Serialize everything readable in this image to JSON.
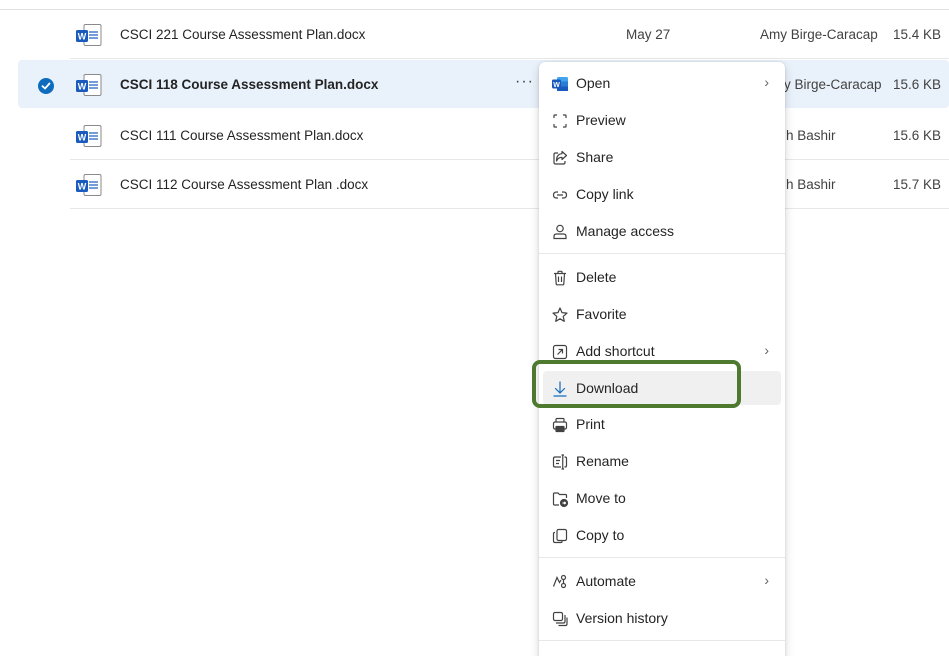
{
  "files": [
    {
      "name": "CSCI 221 Course Assessment Plan.docx",
      "date": "May 27",
      "owner": "Amy Birge-Caracap",
      "size": "15.4 KB",
      "selected": false
    },
    {
      "name": "CSCI 118 Course Assessment Plan.docx",
      "date": "",
      "owner": "y Birge-Caracap",
      "size": "15.6 KB",
      "selected": true,
      "more": "···"
    },
    {
      "name": "CSCI 111 Course Assessment Plan.docx",
      "date": "",
      "owner": "h Bashir",
      "size": "15.6 KB",
      "selected": false
    },
    {
      "name": "CSCI 112 Course Assessment Plan .docx",
      "date": "",
      "owner": "h Bashir",
      "size": "15.7 KB",
      "selected": false
    }
  ],
  "context_menu": {
    "items": [
      {
        "label": "Open",
        "icon": "word-icon",
        "submenu": true
      },
      {
        "label": "Preview",
        "icon": "preview-icon"
      },
      {
        "label": "Share",
        "icon": "share-icon"
      },
      {
        "label": "Copy link",
        "icon": "link-icon"
      },
      {
        "label": "Manage access",
        "icon": "person-icon"
      },
      {
        "label": "Delete",
        "icon": "trash-icon"
      },
      {
        "label": "Favorite",
        "icon": "star-icon"
      },
      {
        "label": "Add shortcut",
        "icon": "shortcut-icon",
        "submenu": true
      },
      {
        "label": "Download",
        "icon": "download-icon",
        "hovered": true
      },
      {
        "label": "Print",
        "icon": "print-icon"
      },
      {
        "label": "Rename",
        "icon": "rename-icon"
      },
      {
        "label": "Move to",
        "icon": "move-icon"
      },
      {
        "label": "Copy to",
        "icon": "copy-icon"
      },
      {
        "label": "Automate",
        "icon": "automate-icon",
        "submenu": true
      },
      {
        "label": "Version history",
        "icon": "history-icon"
      }
    ],
    "chevron": "›"
  },
  "colors": {
    "accent": "#0f6cbd",
    "word_blue": "#185abd",
    "highlight": "#4e7a2f",
    "selected_row": "#e9f1fb"
  }
}
